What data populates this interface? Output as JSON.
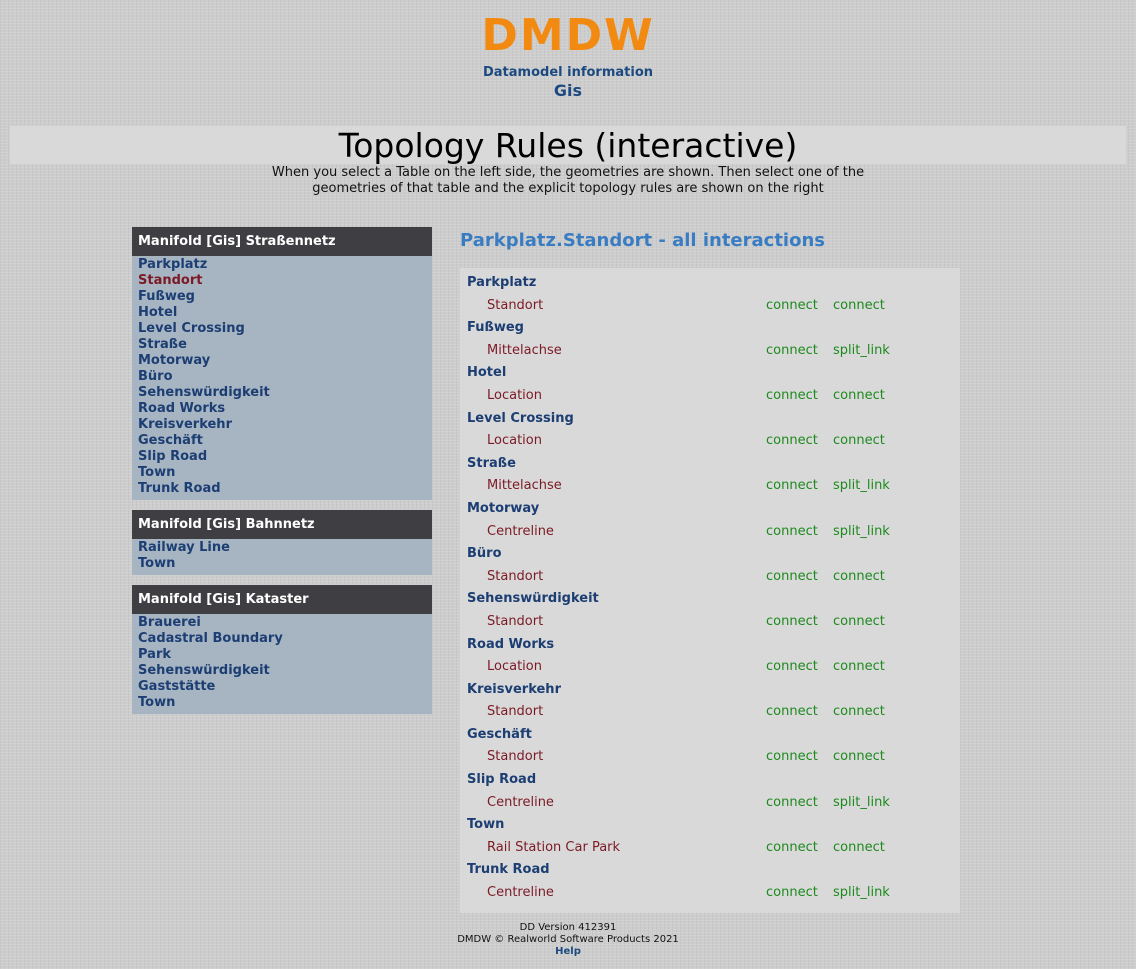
{
  "header": {
    "logo": "DMDW",
    "subtitle": "Datamodel information",
    "model": "Gis"
  },
  "page": {
    "title": "Topology Rules (interactive)",
    "description": "When you select a Table on the left side, the geometries are shown. Then select one of the geometries of that table and the explicit topology rules are shown on the right"
  },
  "panels": [
    {
      "title": "Manifold [Gis] Straßennetz",
      "items": [
        "Parkplatz",
        "Standort",
        "Fußweg",
        "Hotel",
        "Level Crossing",
        "Straße",
        "Motorway",
        "Büro",
        "Sehenswürdigkeit",
        "Road Works",
        "Kreisverkehr",
        "Geschäft",
        "Slip Road",
        "Town",
        "Trunk Road"
      ],
      "selected_index": 1
    },
    {
      "title": "Manifold [Gis] Bahnnetz",
      "items": [
        "Railway Line",
        "Town"
      ],
      "selected_index": -1
    },
    {
      "title": "Manifold [Gis] Kataster",
      "items": [
        "Brauerei",
        "Cadastral Boundary",
        "Park",
        "Sehenswürdigkeit",
        "Gaststätte",
        "Town"
      ],
      "selected_index": -1
    }
  ],
  "interactions": {
    "title": "Parkplatz.Standort - all interactions",
    "groups": [
      {
        "table": "Parkplatz",
        "geometry": "Standort",
        "rule1": "connect",
        "rule2": "connect"
      },
      {
        "table": "Fußweg",
        "geometry": "Mittelachse",
        "rule1": "connect",
        "rule2": "split_link"
      },
      {
        "table": "Hotel",
        "geometry": "Location",
        "rule1": "connect",
        "rule2": "connect"
      },
      {
        "table": "Level Crossing",
        "geometry": "Location",
        "rule1": "connect",
        "rule2": "connect"
      },
      {
        "table": "Straße",
        "geometry": "Mittelachse",
        "rule1": "connect",
        "rule2": "split_link"
      },
      {
        "table": "Motorway",
        "geometry": "Centreline",
        "rule1": "connect",
        "rule2": "split_link"
      },
      {
        "table": "Büro",
        "geometry": "Standort",
        "rule1": "connect",
        "rule2": "connect"
      },
      {
        "table": "Sehenswürdigkeit",
        "geometry": "Standort",
        "rule1": "connect",
        "rule2": "connect"
      },
      {
        "table": "Road Works",
        "geometry": "Location",
        "rule1": "connect",
        "rule2": "connect"
      },
      {
        "table": "Kreisverkehr",
        "geometry": "Standort",
        "rule1": "connect",
        "rule2": "connect"
      },
      {
        "table": "Geschäft",
        "geometry": "Standort",
        "rule1": "connect",
        "rule2": "connect"
      },
      {
        "table": "Slip Road",
        "geometry": "Centreline",
        "rule1": "connect",
        "rule2": "split_link"
      },
      {
        "table": "Town",
        "geometry": "Rail Station Car Park",
        "rule1": "connect",
        "rule2": "connect"
      },
      {
        "table": "Trunk Road",
        "geometry": "Centreline",
        "rule1": "connect",
        "rule2": "split_link"
      }
    ]
  },
  "footer": {
    "version": "DD Version 412391",
    "copyright": "DMDW © Realworld Software Products 2021",
    "help": "Help"
  }
}
